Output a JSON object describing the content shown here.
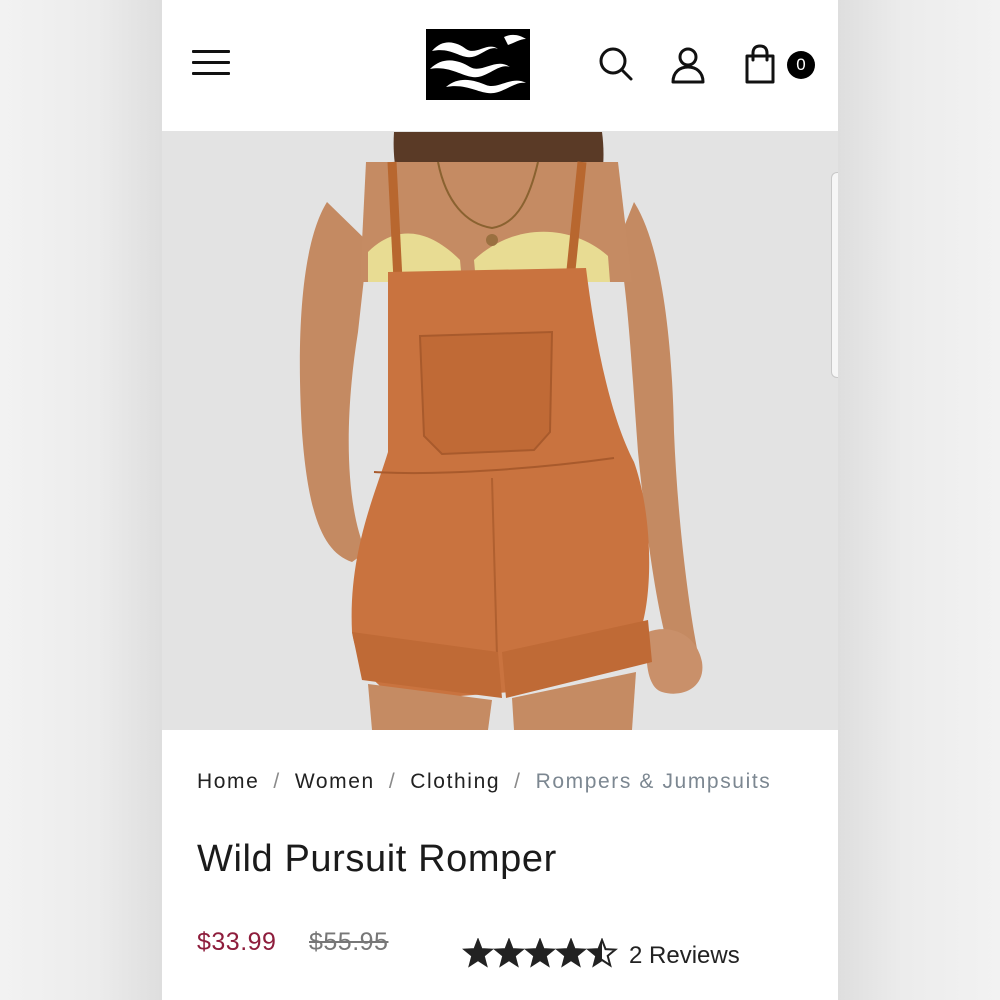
{
  "header": {
    "cart_count": "0",
    "icons": [
      "menu-icon",
      "brand-logo",
      "search-icon",
      "user-icon",
      "shopping-bag-icon"
    ]
  },
  "product_image": {
    "colors": {
      "garment": "#c9733f",
      "background": "#e3e3e3",
      "skin": "#c58b63",
      "top": "#e8dc93"
    }
  },
  "breadcrumb": {
    "items": [
      "Home",
      "Women",
      "Clothing",
      "Rompers & Jumpsuits"
    ],
    "separator": "/"
  },
  "product": {
    "title": "Wild Pursuit Romper",
    "sale_price": "$33.99",
    "original_price": "$55.95",
    "rating": 4.5,
    "rating_max": 5,
    "reviews_label": "2 Reviews"
  },
  "colors": {
    "sale_price": "#8e1d3c",
    "breadcrumb_current": "#7c8791",
    "text": "#1b1b1b"
  }
}
